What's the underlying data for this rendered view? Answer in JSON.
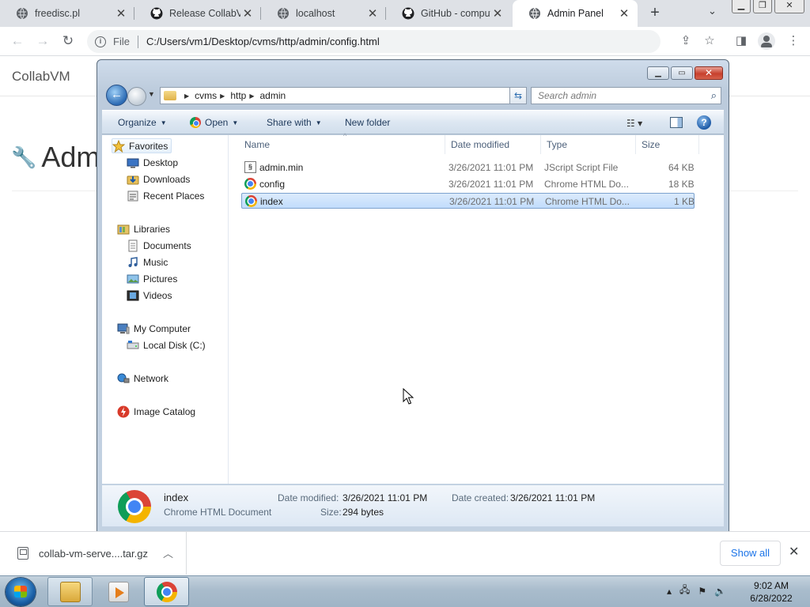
{
  "browser": {
    "tabs": [
      {
        "title": "freedisc.pl",
        "icon": "globe-icon"
      },
      {
        "title": "Release CollabVM",
        "icon": "github-icon"
      },
      {
        "title": "localhost",
        "icon": "globe-icon"
      },
      {
        "title": "GitHub - compute",
        "icon": "github-icon"
      },
      {
        "title": "Admin Panel",
        "icon": "globe-icon",
        "active": true
      }
    ],
    "address": {
      "scheme_label": "File",
      "url": "C:/Users/vm1/Desktop/cvms/http/admin/config.html"
    }
  },
  "page": {
    "brand": "CollabVM",
    "heading": "Adm"
  },
  "explorer": {
    "breadcrumb": [
      "cvms",
      "http",
      "admin"
    ],
    "search_placeholder": "Search admin",
    "commands": {
      "organize": "Organize",
      "open": "Open",
      "share_with": "Share with",
      "new_folder": "New folder"
    },
    "nav": {
      "favorites": "Favorites",
      "desktop": "Desktop",
      "downloads": "Downloads",
      "recent_places": "Recent Places",
      "libraries": "Libraries",
      "documents": "Documents",
      "music": "Music",
      "pictures": "Pictures",
      "videos": "Videos",
      "my_computer": "My Computer",
      "local_disk": "Local Disk (C:)",
      "network": "Network",
      "image_catalog": "Image Catalog"
    },
    "columns": {
      "name": "Name",
      "date_modified": "Date modified",
      "type": "Type",
      "size": "Size"
    },
    "files": [
      {
        "name": "admin.min",
        "date": "3/26/2021 11:01 PM",
        "type": "JScript Script File",
        "size": "64 KB",
        "icon": "js-file-icon"
      },
      {
        "name": "config",
        "date": "3/26/2021 11:01 PM",
        "type": "Chrome HTML Do...",
        "size": "18 KB",
        "icon": "chrome-file-icon"
      },
      {
        "name": "index",
        "date": "3/26/2021 11:01 PM",
        "type": "Chrome HTML Do...",
        "size": "1 KB",
        "icon": "chrome-file-icon",
        "selected": true
      }
    ],
    "details": {
      "name": "index",
      "type": "Chrome HTML Document",
      "date_modified_label": "Date modified:",
      "date_modified": "3/26/2021 11:01 PM",
      "date_created_label": "Date created:",
      "date_created": "3/26/2021 11:01 PM",
      "size_label": "Size:",
      "size": "294 bytes"
    }
  },
  "downloads": {
    "item": "collab-vm-serve....tar.gz",
    "show_all": "Show all"
  },
  "taskbar": {
    "time": "9:02 AM",
    "date": "6/28/2022"
  }
}
